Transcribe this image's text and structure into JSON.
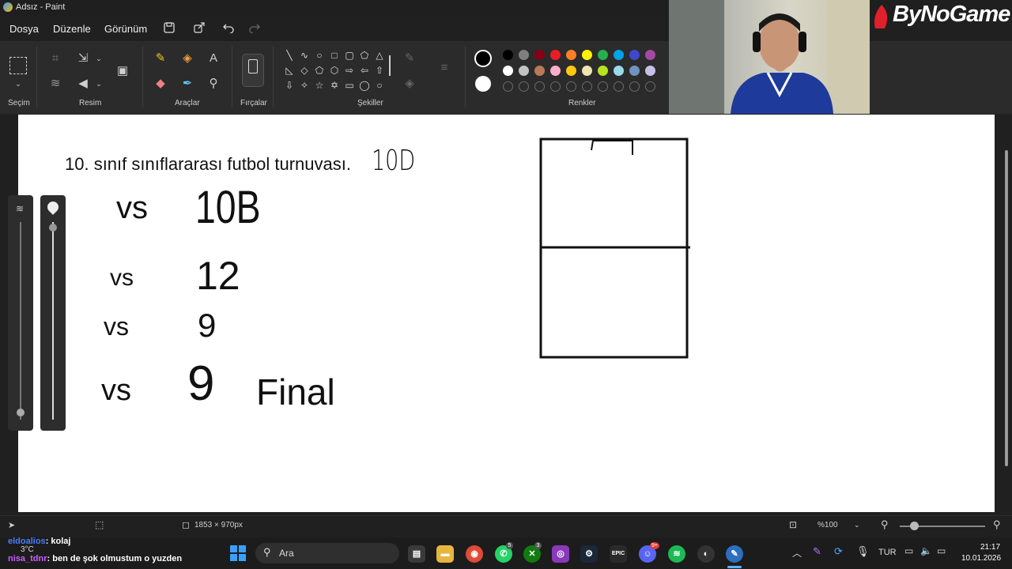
{
  "window": {
    "title": "Adsız - Paint"
  },
  "menu": {
    "file": "Dosya",
    "edit": "Düzenle",
    "view": "Görünüm"
  },
  "ribbon": {
    "groups": {
      "selection": "Seçim",
      "image": "Resim",
      "tools": "Araçlar",
      "brushes": "Fırçalar",
      "shapes": "Şekiller",
      "colors": "Renkler"
    }
  },
  "colors": {
    "primary": "#000000",
    "secondary": "#ffffff",
    "row1": [
      "#000000",
      "#7f7f7f",
      "#880015",
      "#ed1c24",
      "#ff7f27",
      "#fff200",
      "#22b14c",
      "#00a2e8",
      "#3f48cc",
      "#a349a4"
    ],
    "row2": [
      "#ffffff",
      "#c3c3c3",
      "#b97a57",
      "#ffaec9",
      "#ffc90e",
      "#efe4b0",
      "#b5e61d",
      "#99d9ea",
      "#7092be",
      "#c8bfe7"
    ]
  },
  "canvas": {
    "heading": "10. sınıf sınıflararası futbol turnuvası.",
    "team": "10D",
    "matches": [
      {
        "vs": "vs",
        "opponent": "10B",
        "note": ""
      },
      {
        "vs": "vs",
        "opponent": "12",
        "note": ""
      },
      {
        "vs": "vs",
        "opponent": "9",
        "note": ""
      },
      {
        "vs": "vs",
        "opponent": "9",
        "note": "Final"
      }
    ]
  },
  "status": {
    "size": "1853 × 970px",
    "zoom": "%100"
  },
  "overlay": {
    "brand": "ByNoGame"
  },
  "chat": [
    {
      "user": "eldoalios",
      "message": ": kolaj"
    },
    {
      "user": "nisa_tdnr",
      "message": ": ben de şok olmustum o yuzden"
    }
  ],
  "taskbar": {
    "search_label": "Ara",
    "weather": "3°C",
    "lang": "TUR",
    "time": "21:17",
    "date": "10.01.2026",
    "badges": {
      "whatsapp": "5",
      "xbox": "3",
      "discord": "9+"
    }
  }
}
